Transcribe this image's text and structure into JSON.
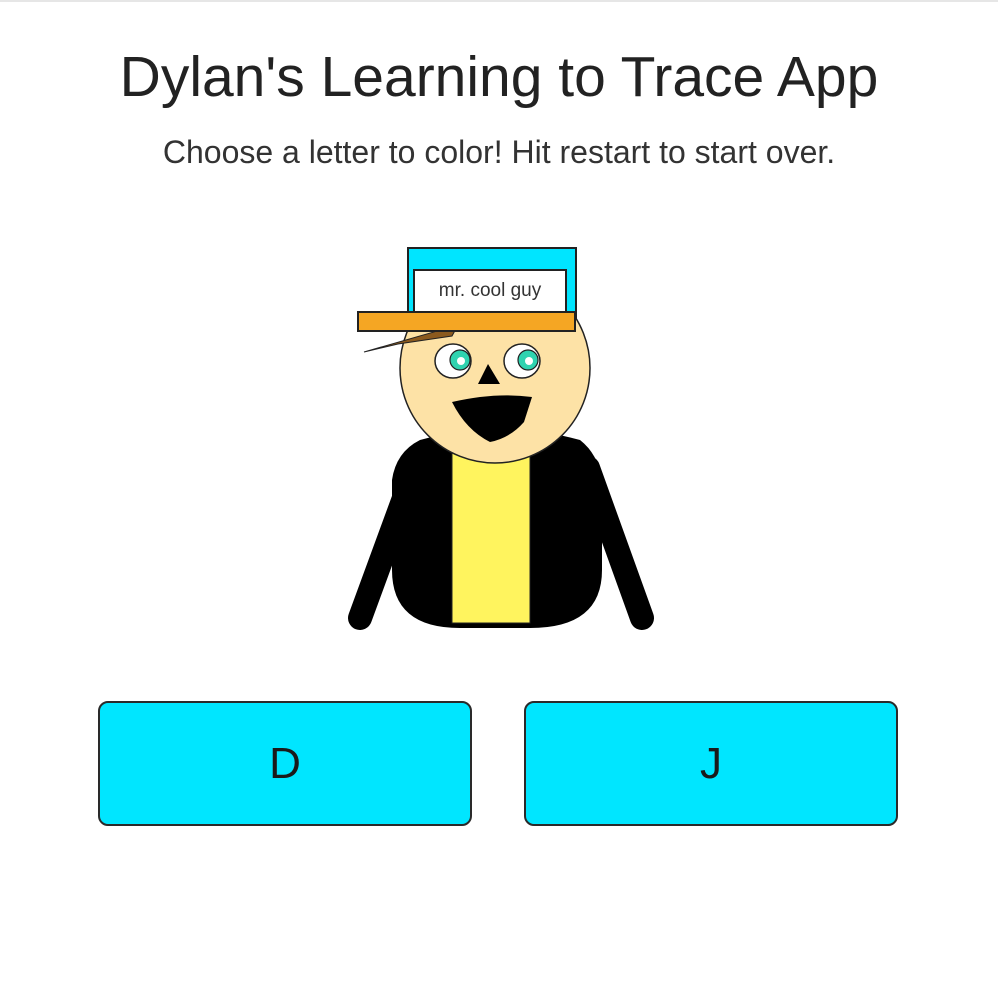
{
  "header": {
    "title": "Dylan's Learning to Trace App",
    "subtitle": "Choose a letter to color! Hit restart to start over."
  },
  "character": {
    "hat_label": "mr. cool guy",
    "colors": {
      "hat_top": "#00e5ff",
      "hat_brim": "#f5a623",
      "skin": "#fde2a6",
      "hair": "#8b5a1e",
      "eye_iris": "#2fd3b0",
      "jacket": "#000000",
      "shirt": "#fff45e"
    }
  },
  "letters": [
    {
      "label": "D"
    },
    {
      "label": "J"
    }
  ],
  "colors": {
    "button_fill": "#00e6ff",
    "title_text": "#222222"
  }
}
